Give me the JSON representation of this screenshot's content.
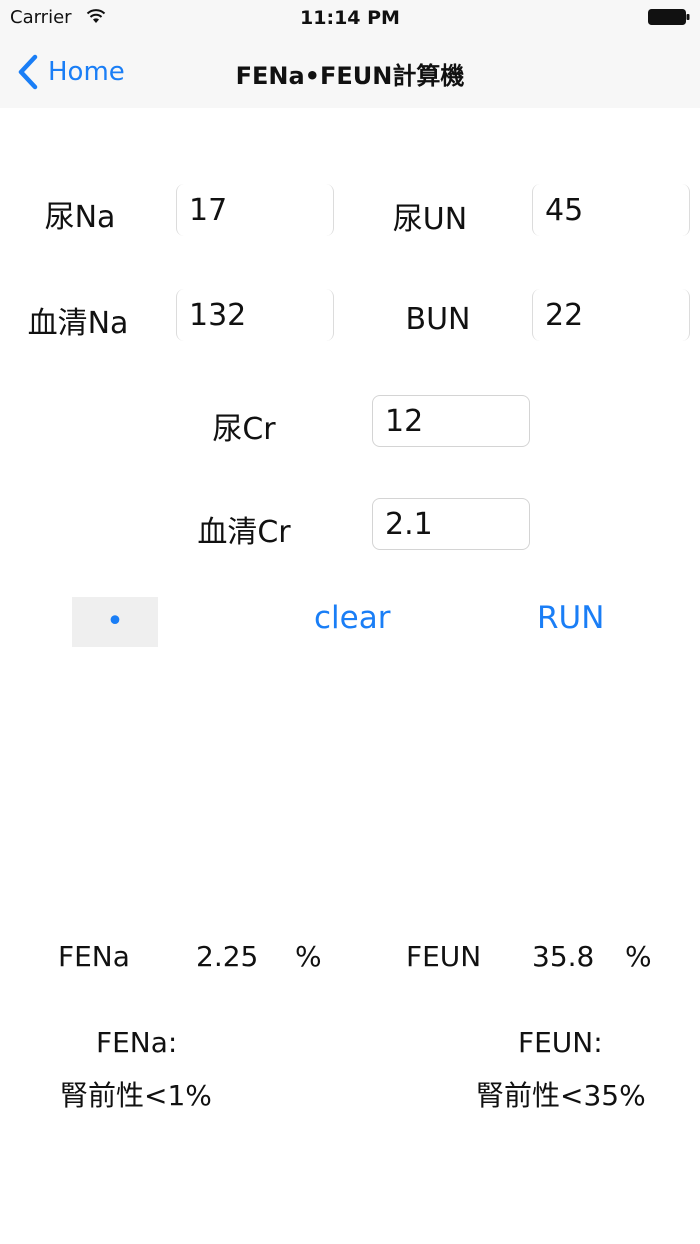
{
  "status_bar": {
    "carrier": "Carrier",
    "time": "11:14 PM"
  },
  "nav": {
    "back_label": "Home",
    "title": "FENa•FEUN計算機"
  },
  "inputs": {
    "urine_na": {
      "label": "尿Na",
      "value": "17"
    },
    "urine_un": {
      "label": "尿UN",
      "value": "45"
    },
    "serum_na": {
      "label": "血清Na",
      "value": "132"
    },
    "bun": {
      "label": "BUN",
      "value": "22"
    },
    "urine_cr": {
      "label": "尿Cr",
      "value": "12"
    },
    "serum_cr": {
      "label": "血清Cr",
      "value": "2.1"
    }
  },
  "buttons": {
    "dot": "•",
    "clear": "clear",
    "run": "RUN"
  },
  "results": {
    "fena": {
      "label": "FENa",
      "value": "2.25",
      "unit": "%"
    },
    "feun": {
      "label": "FEUN",
      "value": "35.8",
      "unit": "%"
    }
  },
  "notes": {
    "fena_title": "FENa:",
    "fena_text": "腎前性<1%",
    "feun_title": "FEUN:",
    "feun_text": "腎前性<35%"
  },
  "colors": {
    "accent": "#1a7ef6",
    "bar_background": "#f7f7f7"
  }
}
